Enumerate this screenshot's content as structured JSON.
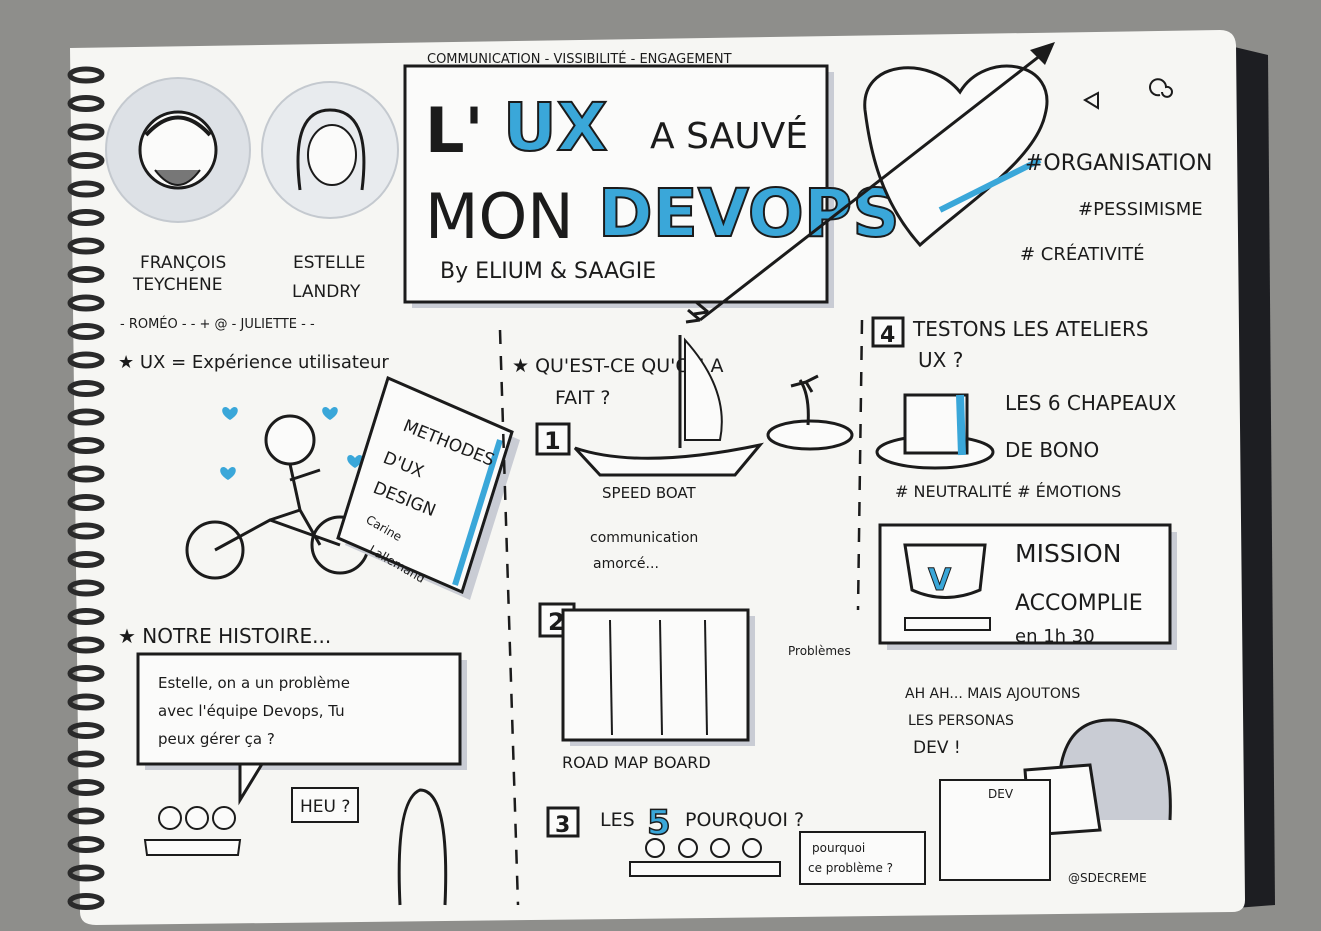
{
  "header": {
    "tagline": "COMMUNICATION - VISSIBILITÉ - ENGAGEMENT",
    "title_line1_a": "L'",
    "title_line1_b": "UX",
    "title_line1_c": "A SAUVÉ",
    "title_line2_a": "MON",
    "title_line2_b": "DEVOPS",
    "byline": "By ELIUM & SAAGIE"
  },
  "hashtags": [
    "#ORGANISATION",
    "#PESSIMISME",
    "# CRÉATIVITÉ"
  ],
  "speakers": [
    {
      "first": "FRANÇOIS",
      "last": "TEYCHENE"
    },
    {
      "first": "ESTELLE",
      "last": "LANDRY"
    }
  ],
  "nicknames": "- ROMÉO - - + @ - JULIETTE - -",
  "ux_definition": "★ UX = Expérience utilisateur",
  "book": {
    "line1": "METHODES",
    "line2": "D'UX",
    "line3": "DESIGN",
    "author1": "Carine",
    "author2": "Lallemand"
  },
  "story": {
    "heading": "★ NOTRE HISTOIRE...",
    "bubble": [
      "Estelle, on a un problème",
      "avec l'équipe Devops, Tu",
      "peux gérer ça ?"
    ],
    "reply": "HEU ?"
  },
  "middle": {
    "heading_1": "★ QU'EST-CE QU'ON A",
    "heading_2": "FAIT ?",
    "step1_num": "1",
    "step1_label": "SPEED BOAT",
    "step1_note_1": "communication",
    "step1_note_2": "amorcé...",
    "step2_num": "2",
    "step2_label": "ROAD MAP BOARD",
    "problems_label": "Problèmes",
    "personas_1": "AH AH... MAIS AJOUTONS",
    "personas_2": "LES PERSONAS",
    "personas_3": "DEV !",
    "step3_num": "3",
    "step3_a": "LES",
    "step3_b": "5",
    "step3_c": "POURQUOI ?",
    "step3_bubble_1": "pourquoi",
    "step3_bubble_2": "ce problème ?"
  },
  "right": {
    "step4_num": "4",
    "step4_1": "TESTONS LES ATELIERS",
    "step4_2": "UX ?",
    "hats_1": "LES 6 CHAPEAUX",
    "hats_2": "DE BONO",
    "hats_tags": "# NEUTRALITÉ   # ÉMOTIONS",
    "mission_1": "MISSION",
    "mission_2": "ACCOMPLIE",
    "mission_3": "en 1h 30",
    "dev_label": "DEV",
    "signature": "@SDECREME"
  },
  "colors": {
    "accent": "#3aa7d9",
    "ink": "#1b1b1b",
    "paper": "#f7f7f5",
    "shadow": "#b9bcc6"
  }
}
